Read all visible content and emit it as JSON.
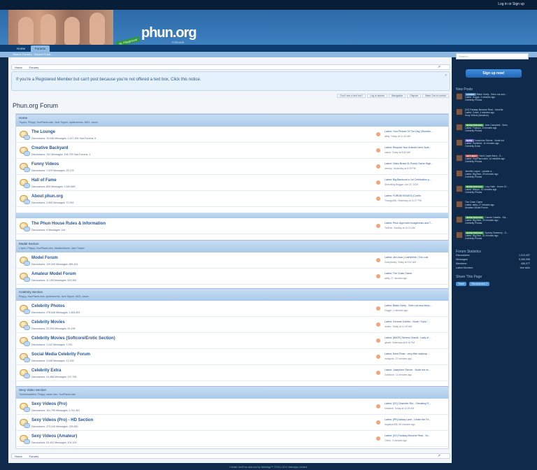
{
  "topbar": {
    "account": "Log in or Sign up"
  },
  "header": {
    "logo": "phun.org",
    "logo_sub": "FORUMS",
    "tag": "NL Playground"
  },
  "nav": {
    "tabs": [
      "Home",
      "Forums"
    ],
    "sub": "Search Forums · Recent Posts"
  },
  "breadcrumb": [
    "Home",
    "Forums"
  ],
  "notice": {
    "text": "If you're a Registered Member but can't post because you're not offered a text box, Click this notice."
  },
  "tools": [
    "Don't see a text box?",
    "Log in Issues",
    "Navigation",
    "Dispute",
    "Mark Out of control"
  ],
  "page_title": "Phun.org Forum",
  "sections": [
    {
      "title": "Home",
      "sub": "Tripper, Phlppy, YourPlaceLosin, Jack Tripper, spiderworms, 6621, zazzn"
    },
    {
      "title": "Model Section",
      "sub": "L'ripen, Phlppy, YourPlaceLosin, MadsenMazer, Jack Tripper"
    },
    {
      "title": "Celebrity Section",
      "sub": "Phlppy, YourPlaceLosin, spiderworms, Jack Tripper, 6621, zazzn"
    },
    {
      "title": "Sexy Video Section",
      "sub": "TheAnimalArtist, Phlppy, zazzn sixx, YourPlaceLosin"
    }
  ],
  "forums": [
    {
      "name": "The Lounge",
      "stats": "Discussions: 19,046 Messages: 1,427,354   Sub-Forums: 5",
      "l1": "Latest: Your Picture Of The Day (Stumble...",
      "l2": "abby, Today at 11:32 AM"
    },
    {
      "name": "Creative Backyard",
      "stats": "Discussions: 781 Messages: 106,799   Sub-Forums: 1",
      "l1": "Latest: Request Your Artwork here/ Avat...",
      "l2": "zazzn, Today at 8:52 AM"
    },
    {
      "name": "Funny Videos",
      "stats": "Discussions: 7,925 Messages: 25,176",
      "l1": "Latest: Video Brawl 01 Pointy Game High...",
      "l2": "wemby, Yesterday at 6:09 PM"
    },
    {
      "name": "Hall of Fame",
      "stats": "Discussions: 854 Messages: 1,540,669",
      "l1": "Latest: Big Bamboon's 1st Celebration p...",
      "l2": "Shriveling Beggar, Jan 23, 2020"
    },
    {
      "name": "About phun.org",
      "stats": "Discussions: 2,065 Messages: 72,993",
      "l1": "Latest: FORUM ISSUES (Contin",
      "l2": "Thangu25k, Yesterday at 11:27 PM"
    },
    {
      "name": "The Phun House Rules & Information",
      "stats": "Discussions: 9 Messages: 144",
      "l1": "Latest: Phun Approved Imagehosts and T...",
      "l2": "TedFan, Sunday at 10:22 AM"
    },
    {
      "name": "Model Forum",
      "stats": "Discussions: 129,409 Messages: 685,161",
      "l1": "Latest: Jia Lissa | LushWeek | Trio Lust",
      "l2": "Dorkybarky, Today at 9:02 AM"
    },
    {
      "name": "Amateur Model Forum",
      "stats": "Discussions: 11,155 Messages: 203,350",
      "l1": "Latest: The Chain Game",
      "l2": "abby, 27 minutes ago"
    },
    {
      "name": "Celebrity Photos",
      "stats": "Discussions: 278,646 Messages: 1,804,891",
      "l1": "Latest: Blake Lively - Seen out and abou...",
      "l2": "Hogge, 4 minutes ago"
    },
    {
      "name": "Celebrity Movies",
      "stats": "Discussions: 22,205 Messages: 91,195",
      "l1": "Latest: German Celebs - Nude / Tops / ...",
      "l2": "dudex, Today at 11:49 AM"
    },
    {
      "name": "Celebrity Movies (Softcore/Erotic Section)",
      "stats": "Discussions: 1,242 Messages: 7,291",
      "l1": "Latest: [WATE] Serena Grandi - Lady of ...",
      "l2": "qkwdt, Yesterday at 8:16 PM"
    },
    {
      "name": "Social Media Celebrity Forum",
      "stats": "Discussions: 2,048 Messages: 13,159",
      "l1": "Latest: Demi Rose - very little makeup ...",
      "l2": "minigodx, 37 minutes ago"
    },
    {
      "name": "Celebrity Extra",
      "stats": "Discussions: 24,468 Messages: 197,764",
      "l1": "Latest: Josephine Skriver - Nude bot ev...",
      "l2": "Goldbore, 11 minutes ago"
    },
    {
      "name": "Sexy Videos (Pro)",
      "stats": "Discussions: 161,799 Messages: 1,311,361",
      "l1": "Latest: [XX] Charlotte Stix - Sneaking R...",
      "l2": "sexadoll, Today at 11:09 AM"
    },
    {
      "name": "Sexy Videos (Pro) - HD Section",
      "stats": "Discussions: 373,045 Messages: 226,850",
      "l1": "Latest: [PR] Adissy Lane - Under the Fe...",
      "l2": "doyabye555, 59 minutes ago"
    },
    {
      "name": "Sexy Videos (Amateur)",
      "stats": "Discussions: 25,402 Messages: 104,109",
      "l1": "Latest: [XX] Fantasy Become Real - Vo...",
      "l2": "Celee, 4 minutes ago"
    }
  ],
  "sidebar": {
    "search_placeholder": "Search...",
    "signup": "Sign up now!",
    "new_posts_title": "New Posts",
    "posts": [
      {
        "badge": "CANDID",
        "title": "Blake Lively - Seen out and...",
        "meta": "Latest: Hogge, 4 minutes ago",
        "forum": "Celebrity Photos"
      },
      {
        "badge": "",
        "title": "[XX] Fantasy Become Real - VolceVa",
        "meta": "Latest: Celee, 4 minutes ago",
        "forum": "Sexy Videos (Amateur)"
      },
      {
        "badge": "NUDE/TOPLESS",
        "title": "Jeen Campbell - Seen",
        "meta": "Latest: Thampo, 8 minutes ago",
        "forum": "Celebrity Photos"
      },
      {
        "badge": "NUDE",
        "title": "Josephine Skriver - Nude bot",
        "meta": "Latest: Goldbore, 11 minutes ago",
        "forum": "Celebrity Extra"
      },
      {
        "badge": "HOT SEXY",
        "title": "Heidi Caper Berry - E...",
        "meta": "Latest: YourPlacLostin, 14 minutes ago",
        "forum": "Celebrity Photos"
      },
      {
        "badge": "",
        "title": "Jennifer Lopez - outside a...",
        "meta": "Latest: Big Beni, 20 minutes ago",
        "forum": "Celebrity Photos"
      },
      {
        "badge": "NUDE/TOPLESS",
        "title": "Lucy Hale - Home 12...",
        "meta": "Latest: Blimpo, 20 minutes ago",
        "forum": "Celebrity Photos"
      },
      {
        "badge": "",
        "title": "The Chain Game",
        "meta": "Latest: abby, 27 minutes ago",
        "forum": "Amateur Model Forum"
      },
      {
        "badge": "NUDE/TOPLESS",
        "title": "Connie Cabello - Kis...",
        "meta": "Latest: Big Beni, 29 minutes ago",
        "forum": "Celebrity Photos"
      },
      {
        "badge": "NUDE/TOPLESS",
        "title": "Sydney Sweeney - D...",
        "meta": "Latest: Big Beni, 31 minutes ago",
        "forum": "Celebrity Photos"
      }
    ],
    "stats_title": "Forum Statistics",
    "stats": [
      {
        "label": "Discussions:",
        "value": "1,013,497"
      },
      {
        "label": "Messages:",
        "value": "9,265,998"
      },
      {
        "label": "Members:",
        "value": "456,977"
      },
      {
        "label": "Latest Member:",
        "value": "free sicle"
      }
    ],
    "share_title": "Share This Page",
    "share": [
      "Tweet",
      "Recommend 2"
    ]
  },
  "footer": "Certain XenForo add-ons by Waindigo™ ©2011-2012 Waindigo Limited."
}
